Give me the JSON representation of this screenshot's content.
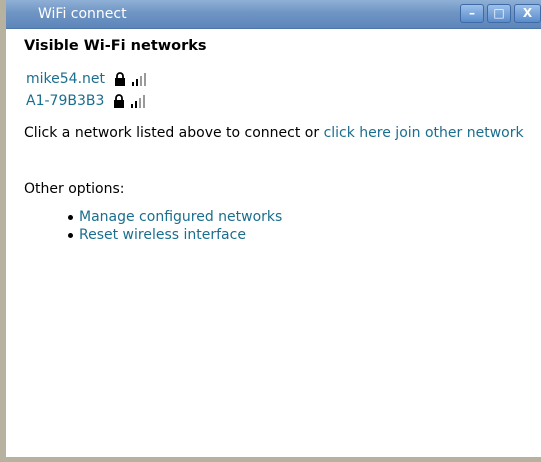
{
  "window": {
    "title": "WiFi connect",
    "minimize_label": "–",
    "maximize_label": "□",
    "close_label": "X"
  },
  "heading": "Visible Wi-Fi networks",
  "networks": [
    {
      "ssid": "mike54.net",
      "icon_lock": "lock-icon",
      "icon_signal": "signal-strength-icon"
    },
    {
      "ssid": "A1-79B3B3",
      "icon_lock": "lock-icon",
      "icon_signal": "signal-strength-icon"
    }
  ],
  "instruction": {
    "text": "Click a network listed above to connect or ",
    "link": "click here join other network"
  },
  "other_options": {
    "label": "Other options:",
    "items": [
      {
        "label": "Manage configured networks"
      },
      {
        "label": "Reset wireless interface"
      }
    ]
  },
  "colors": {
    "titlebar": "#6f95c4",
    "link": "#1a6e8e",
    "frame": "#b7b2a0"
  }
}
